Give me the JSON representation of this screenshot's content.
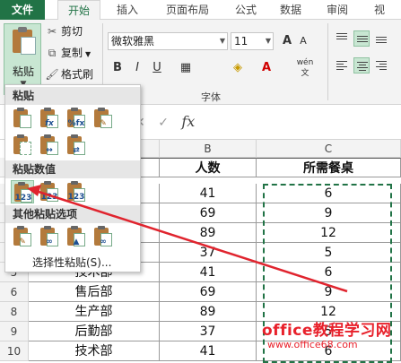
{
  "ribbon": {
    "tabs": [
      "文件",
      "开始",
      "插入",
      "页面布局",
      "公式",
      "数据",
      "审阅",
      "视"
    ],
    "active_tab": "开始",
    "clipboard": {
      "paste_label": "粘贴",
      "cut_label": "剪切",
      "copy_label": "复制",
      "format_painter_label": "格式刷"
    },
    "font": {
      "font_name": "微软雅黑",
      "font_size": "11",
      "bold": "B",
      "italic": "I",
      "underline": "U",
      "phonetic": "wén",
      "grow": "A",
      "shrink": "A",
      "group_label": "字体"
    }
  },
  "formula_bar": {
    "fx_label": "fx"
  },
  "paste_menu": {
    "section_paste": "粘贴",
    "section_values": "粘贴数值",
    "section_other": "其他粘贴选项",
    "values_tags": [
      "123",
      "123",
      "123"
    ],
    "selective_paste": "选择性粘贴(S)..."
  },
  "sheet": {
    "columns": [
      "B",
      "C"
    ],
    "header": {
      "b": "人数",
      "c": "所需餐桌"
    },
    "row_numbers": [
      "5",
      "6",
      "7",
      "8",
      "9",
      "10"
    ],
    "rows": [
      {
        "a": "",
        "b": "41",
        "c": "6"
      },
      {
        "a": "",
        "b": "69",
        "c": "9"
      },
      {
        "a": "",
        "b": "89",
        "c": "12"
      },
      {
        "a": "",
        "b": "37",
        "c": "5"
      },
      {
        "a": "技术部",
        "b": "41",
        "c": "6"
      },
      {
        "a": "售后部",
        "b": "69",
        "c": "9"
      },
      {
        "a": "生产部",
        "b": "89",
        "c": "12"
      },
      {
        "a": "后勤部",
        "b": "37",
        "c": "5"
      },
      {
        "a": "技术部",
        "b": "41",
        "c": "6"
      }
    ]
  },
  "watermark": {
    "title": "office教程学习网",
    "url": "www.office68.com"
  },
  "colors": {
    "accent": "#217346",
    "arrow": "#e0242e"
  }
}
